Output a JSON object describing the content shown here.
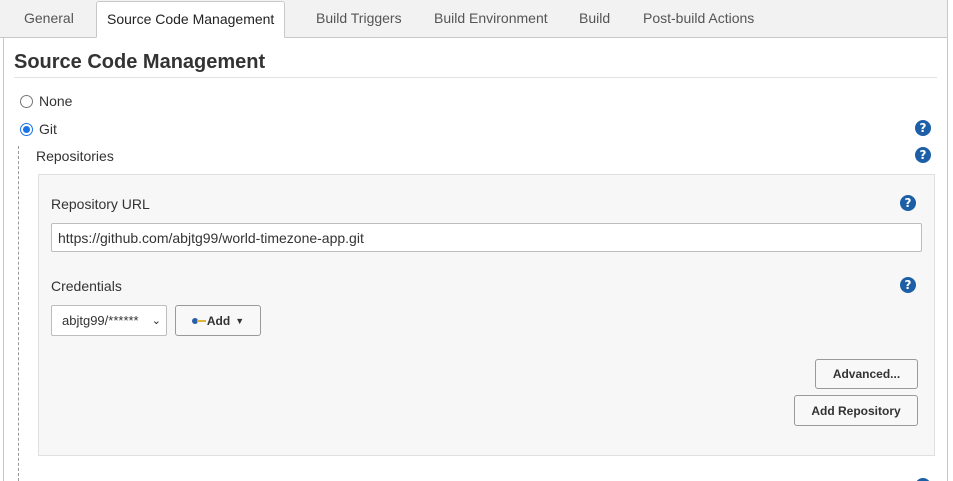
{
  "tabs": [
    {
      "label": "General"
    },
    {
      "label": "Source Code Management"
    },
    {
      "label": "Build Triggers"
    },
    {
      "label": "Build Environment"
    },
    {
      "label": "Build"
    },
    {
      "label": "Post-build Actions"
    }
  ],
  "active_tab": "Source Code Management",
  "section": {
    "title": "Source Code Management"
  },
  "scm_options": [
    {
      "label": "None",
      "checked": false
    },
    {
      "label": "Git",
      "checked": true
    }
  ],
  "repositories": {
    "label": "Repositories",
    "repository_url_label": "Repository URL",
    "repository_url_value": "https://github.com/abjtg99/world-timezone-app.git",
    "credentials_label": "Credentials",
    "credentials_selected": "abjtg99/******",
    "add_button_label": "Add",
    "advanced_button_label": "Advanced...",
    "add_repository_button_label": "Add Repository"
  },
  "help_icon_glyph": "?",
  "colors": {
    "accent": "#1a73e8",
    "help": "#1d5fa6"
  }
}
